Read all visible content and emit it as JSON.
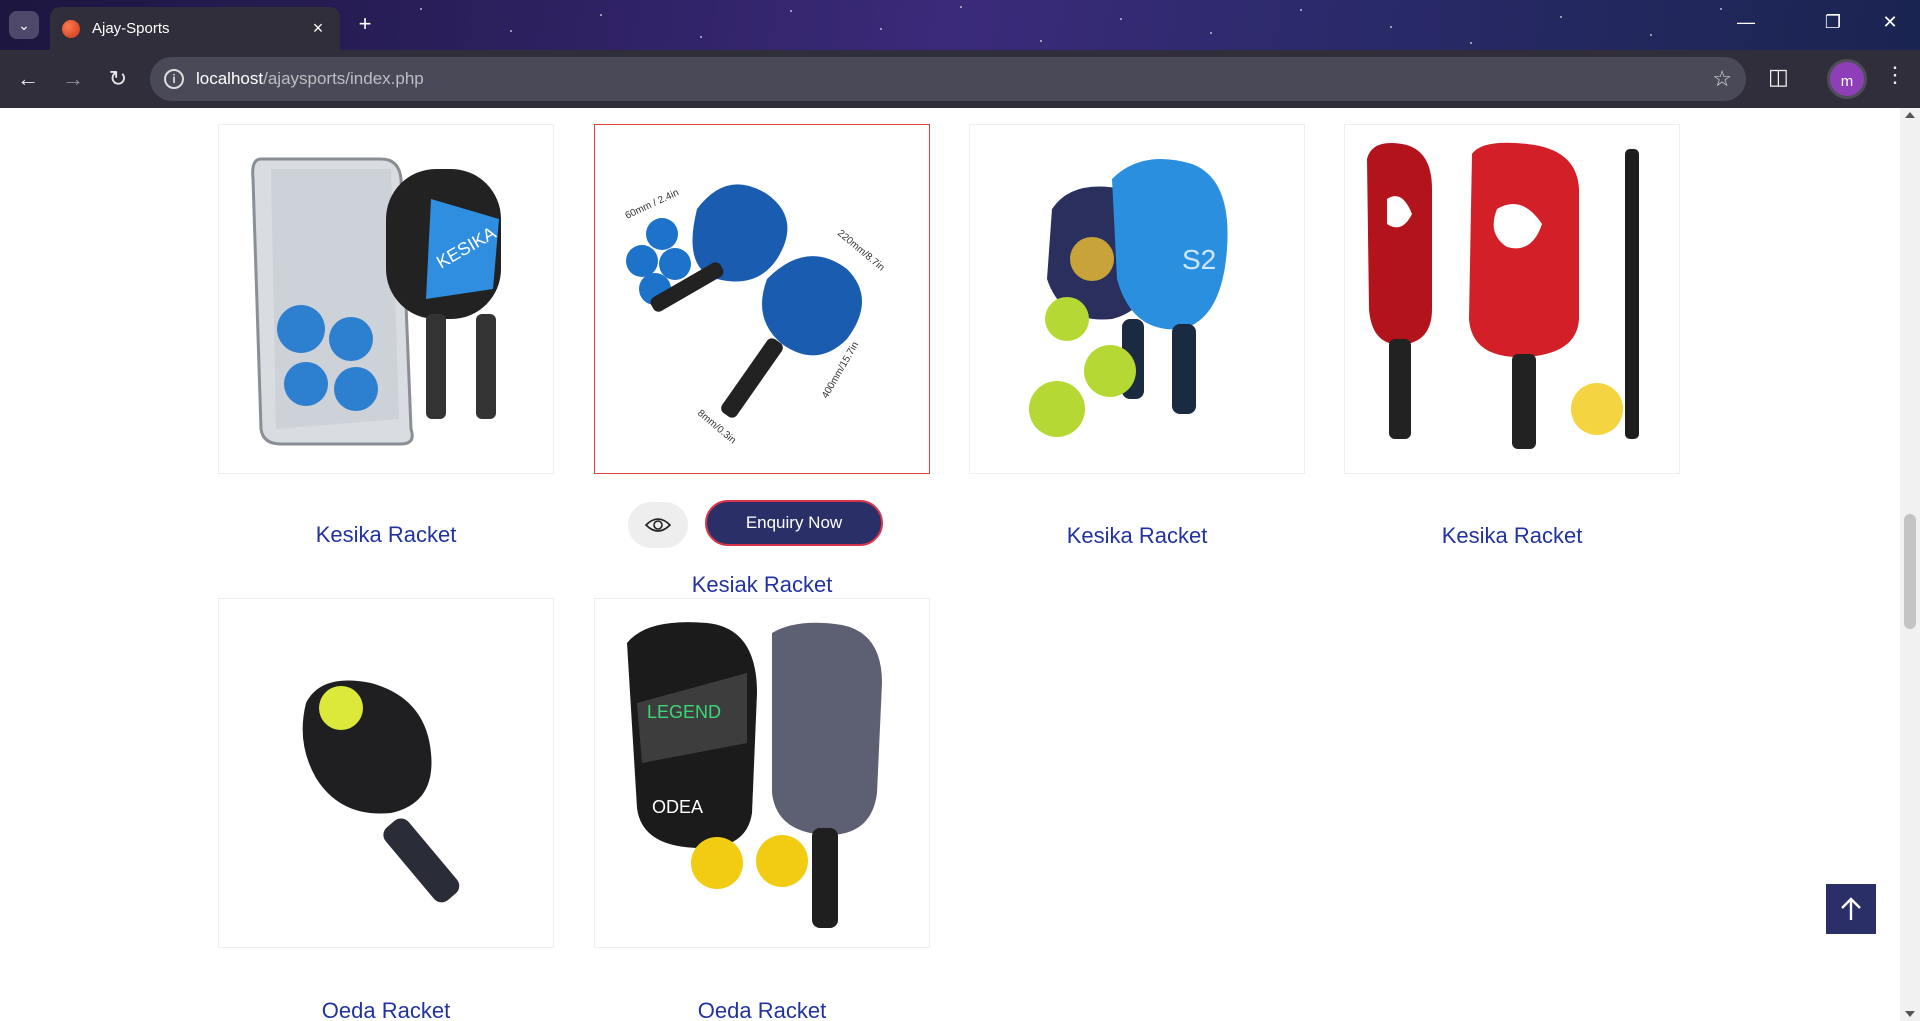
{
  "browser": {
    "tab_title": "Ajay-Sports",
    "url_host": "localhost",
    "url_path": "/ajaysports/index.php",
    "profile_initial": "m",
    "icons": {
      "tab_menu": "chevron-down-icon",
      "tab_close": "close-icon",
      "new_tab": "plus-icon",
      "back": "back-arrow-icon",
      "forward": "forward-arrow-icon",
      "reload": "reload-icon",
      "site_info": "info-icon",
      "bookmark": "star-icon",
      "extensions": "puzzle-icon",
      "menu": "kebab-menu-icon",
      "minimize": "minimize-icon",
      "restore": "restore-icon",
      "close_window": "close-icon"
    }
  },
  "products": [
    {
      "name": "Kesika Racket",
      "image": "kesika-racket-set-with-bag"
    },
    {
      "name": "Kesiak Racket",
      "image": "kesika-racket-pair-dimensions",
      "hovered": true
    },
    {
      "name": "Kesika Racket",
      "image": "blue-racket-with-green-balls"
    },
    {
      "name": "Kesika Racket",
      "image": "red-xspak-rackets"
    },
    {
      "name": "Oeda Racket",
      "image": "black-racket-with-ball"
    },
    {
      "name": "Oeda Racket",
      "image": "legend-racket-with-cover"
    }
  ],
  "actions": {
    "enquiry_label": "Enquiry Now",
    "view_icon": "eye-icon",
    "back_to_top_icon": "arrow-up-icon"
  },
  "colors": {
    "brand_navy": "#2a2f68",
    "product_name": "#2233a0",
    "hover_border": "#e04040"
  }
}
